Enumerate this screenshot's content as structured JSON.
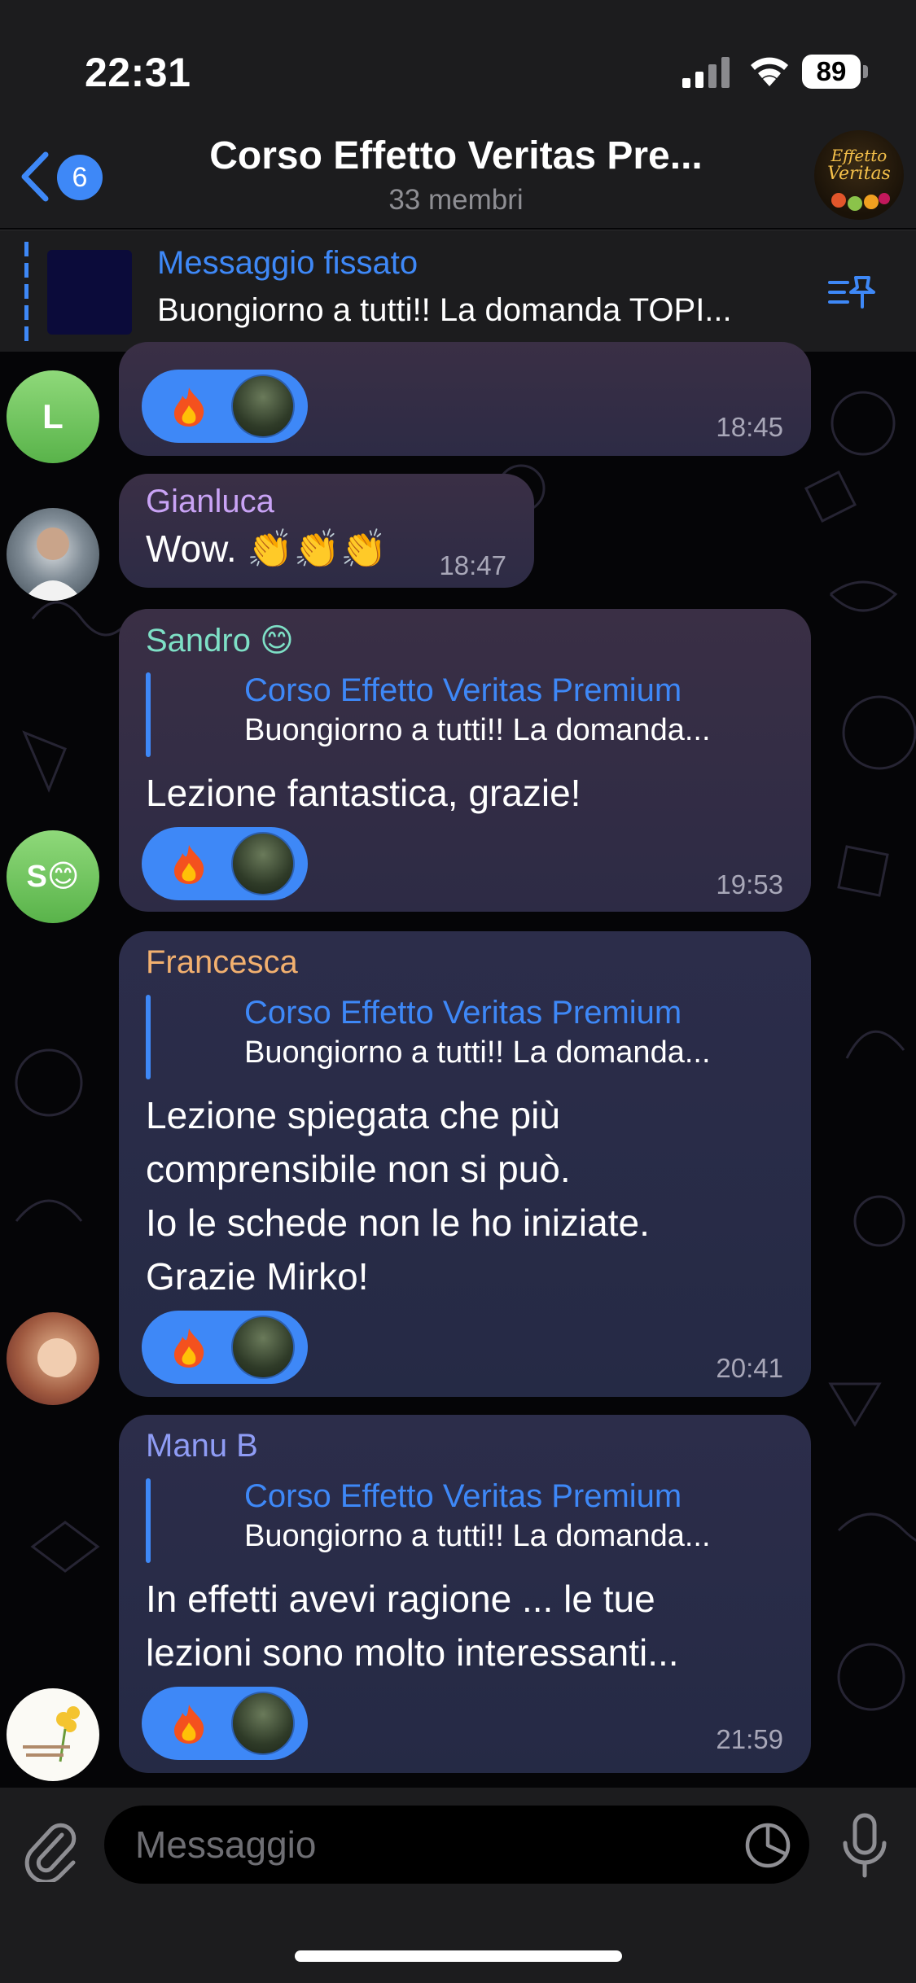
{
  "status_bar": {
    "time": "22:31",
    "battery": "89"
  },
  "header": {
    "back_count": "6",
    "title": "Corso Effetto Veritas Pre...",
    "subtitle": "33 membri"
  },
  "pinned": {
    "label": "Messaggio fissato",
    "text": "Buongiorno a tutti!! La domanda TOPI..."
  },
  "messages": [
    {
      "sender": "",
      "avatar_initial": "L",
      "text": "",
      "reaction": "fire",
      "time": "18:45"
    },
    {
      "sender": "Gianluca",
      "sender_color": "#c9a3f5",
      "text": "Wow. 👏👏👏",
      "time": "18:47"
    },
    {
      "sender": "Sandro 😊",
      "sender_color": "#7ee0c6",
      "avatar_initial": "S😊",
      "reply_name": "Corso Effetto Veritas Premium",
      "reply_text": "Buongiorno a tutti!! La domanda...",
      "text": "Lezione fantastica, grazie!",
      "reaction": "fire",
      "time": "19:53"
    },
    {
      "sender": "Francesca",
      "sender_color": "#f2b06f",
      "reply_name": "Corso Effetto Veritas Premium",
      "reply_text": "Buongiorno a tutti!! La domanda...",
      "text_lines": [
        "Lezione spiegata che più",
        "comprensibile non si può.",
        "Io le schede non le ho iniziate.",
        "Grazie Mirko!"
      ],
      "reaction": "fire",
      "time": "20:41"
    },
    {
      "sender": "Manu B",
      "sender_color": "#8f9cf5",
      "reply_name": "Corso Effetto Veritas Premium",
      "reply_text": "Buongiorno a tutti!! La domanda...",
      "text_lines": [
        "In effetti avevi ragione ... le tue",
        "lezioni sono molto interessanti..."
      ],
      "reaction": "fire",
      "time": "21:59"
    }
  ],
  "input": {
    "placeholder": "Messaggio"
  },
  "colors": {
    "accent": "#3e88f7",
    "bar_bg": "#1c1c1e",
    "bubble": "#2d2b45"
  }
}
